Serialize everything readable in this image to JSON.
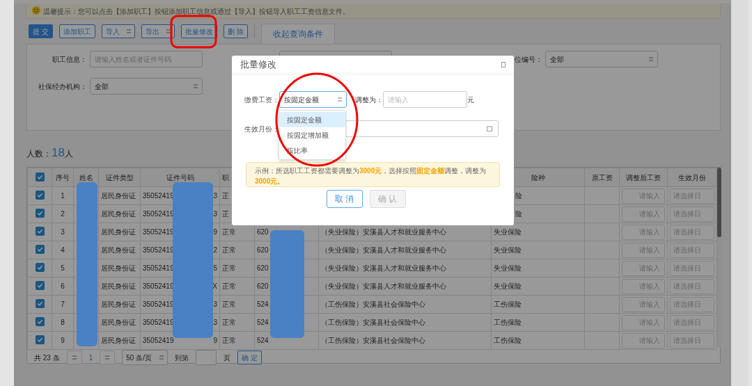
{
  "notice": {
    "text": "温馨提示：您可以点击【添加职工】按钮添加职工信息或通过【导入】按钮导入职工工资信息文件。"
  },
  "toolbar": [
    {
      "label": "提 交",
      "kind": "primary"
    },
    {
      "label": "添加职工",
      "kind": "outline"
    },
    {
      "label": "导入",
      "kind": "dropdown"
    },
    {
      "label": "导出",
      "kind": "dropdown"
    },
    {
      "label": "批量修改",
      "kind": "outline"
    },
    {
      "label": "删 除",
      "kind": "outline"
    }
  ],
  "tabs": [
    {
      "label": "收起查询条件",
      "selected": true
    }
  ],
  "filters": [
    {
      "label": "职工信息：",
      "placeholder": "请输入姓名或者证件号码",
      "kind": "input"
    },
    {
      "label": "位编号：",
      "value": "全部",
      "kind": "select"
    },
    {
      "label": "社保经办机构：",
      "value": "全部",
      "kind": "select"
    }
  ],
  "count": {
    "label": "人数：",
    "value": "18",
    "unit": "人"
  },
  "table": {
    "header_checked": true,
    "columns": [
      "序号",
      "姓名",
      "证件类型",
      "证件号码",
      "职",
      "险种",
      "原工资",
      "调整后工资",
      "生效月份"
    ],
    "rows": [
      {
        "checked": true,
        "no": "1",
        "id_type": "居民身份证",
        "id_start": "35052419",
        "id_end": "3",
        "status": "正",
        "insurance": "险",
        "new_salary": "请输入",
        "month": "请选择日"
      },
      {
        "checked": true,
        "no": "2",
        "id_type": "居民身份证",
        "id_start": "35052419",
        "id_end": "3",
        "status": "正",
        "insurance": "险",
        "new_salary": "请输入",
        "month": "请选择日"
      },
      {
        "checked": true,
        "no": "3",
        "id_type": "居民身份证",
        "id_start": "35052419",
        "id_end": "9",
        "status": "正常",
        "account": "620",
        "org": "（失业保险）安溪县人才和就业服务中心",
        "insurance": "失业保险",
        "new_salary": "请输入",
        "month": "请选择日"
      },
      {
        "checked": true,
        "no": "4",
        "id_type": "居民身份证",
        "id_start": "35052419",
        "id_end": "2",
        "status": "正常",
        "account": "620",
        "org": "（失业保险）安溪县人才和就业服务中心",
        "insurance": "失业保险",
        "new_salary": "请输入",
        "month": "请选择日"
      },
      {
        "checked": true,
        "no": "5",
        "id_type": "居民身份证",
        "id_start": "35052419",
        "id_end": "5",
        "status": "正常",
        "account": "620",
        "org": "（失业保险）安溪县人才和就业服务中心",
        "insurance": "失业保险",
        "new_salary": "请输入",
        "month": "请选择日"
      },
      {
        "checked": true,
        "no": "6",
        "id_type": "居民身份证",
        "id_start": "35052419",
        "id_end": "X",
        "status": "正常",
        "account": "620",
        "org": "（失业保险）安溪县人才和就业服务中心",
        "insurance": "失业保险",
        "new_salary": "请输入",
        "month": "请选择日"
      },
      {
        "checked": true,
        "no": "7",
        "id_type": "居民身份证",
        "id_start": "35052419",
        "id_end": "3",
        "status": "正常",
        "account": "524",
        "org": "（工伤保险）安溪县社会保险中心",
        "insurance": "工伤保险",
        "new_salary": "请输入",
        "month": "请选择日"
      },
      {
        "checked": true,
        "no": "8",
        "id_type": "居民身份证",
        "id_start": "35052419",
        "id_end": "3",
        "status": "正常",
        "account": "524",
        "org": "（工伤保险）安溪县社会保险中心",
        "insurance": "工伤保险",
        "new_salary": "请输入",
        "month": "请选择日"
      },
      {
        "checked": true,
        "no": "9",
        "id_type": "居民身份证",
        "id_start": "35052419",
        "id_end": "9",
        "status": "正常",
        "account": "524",
        "org": "（工伤保险）安溪县社会保险中心",
        "insurance": "工伤保险",
        "new_salary": "请输入",
        "month": "请选择日"
      }
    ]
  },
  "pagination": {
    "total": "共 23 条",
    "page": "1",
    "page_size": "50 条/页",
    "goto": "到第",
    "page_unit": "页",
    "confirm": "确 定"
  },
  "modal": {
    "title": "批量修改",
    "salary_label": "缴费工资：",
    "salary_mode": "按固定金额",
    "adjust_label": "调整为：",
    "adjust_placeholder": "请输入",
    "unit": "元",
    "month_label": "生效月份：",
    "options": [
      {
        "label": "按固定金额",
        "selected": true
      },
      {
        "label": "按固定增加额",
        "selected": false
      },
      {
        "label": "按比率",
        "selected": false
      }
    ],
    "example": "示例：所选职工工资都需要调整为**3000元**，选择按照**固定金额**调整，调整为**3000元。**",
    "buttons": [
      {
        "label": "取 消",
        "disabled": false
      },
      {
        "label": "确 认",
        "disabled": true
      }
    ]
  }
}
